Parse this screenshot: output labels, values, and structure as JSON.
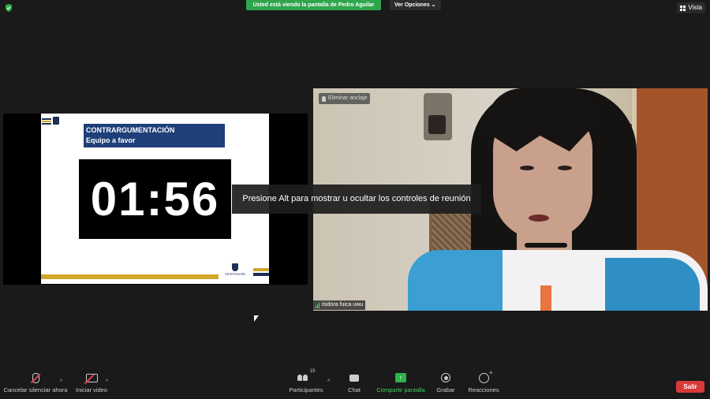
{
  "top": {
    "banner": "Usted está viendo la pantalla de Pedro Aguilar",
    "view_options": "Ver Opciones ⌄",
    "view_button": "Vista"
  },
  "slide": {
    "title_line1": "CONTRARGUMENTACIÓN",
    "title_line2": "Equipo a favor",
    "timer": "01:56",
    "brand": "MONTESSORI"
  },
  "video": {
    "unpin_label": "Eliminar anclaje",
    "participant_name": "isidora fuica uwu"
  },
  "tooltip": "Presione Alt para mostrar u ocultar los controles de reunión",
  "toolbar": {
    "mute": "Cancelar silenciar ahora",
    "video": "Iniciar video",
    "participants": "Participantes",
    "participant_count": "19",
    "chat": "Chat",
    "share": "Compartir pantalla",
    "record": "Grabar",
    "reactions": "Reacciones",
    "leave": "Salir"
  },
  "colors": {
    "banner_green": "#2fa54c",
    "leave_red": "#d83a3a",
    "slide_title_blue": "#1e3f79",
    "slide_gold": "#d4a72c"
  }
}
